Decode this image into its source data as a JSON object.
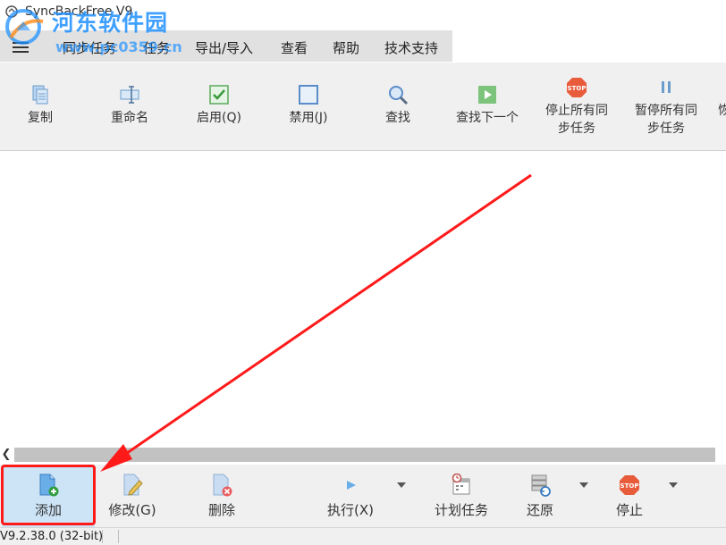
{
  "window": {
    "title": "SyncBackFree V9",
    "watermark_text": "河东软件园",
    "watermark_url": "www.pc0359.cn"
  },
  "menu": {
    "items": [
      "同步任务",
      "任务",
      "导出/导入",
      "查看",
      "帮助",
      "技术支持"
    ]
  },
  "toolbar": {
    "buttons": [
      {
        "label": "复制",
        "icon": "copy-icon"
      },
      {
        "label": "重命名",
        "icon": "rename-icon"
      },
      {
        "label": "启用(Q)",
        "icon": "enable-icon"
      },
      {
        "label": "禁用(J)",
        "icon": "disable-icon"
      },
      {
        "label": "查找",
        "icon": "search-icon"
      },
      {
        "label": "查找下一个",
        "icon": "find-next-icon"
      },
      {
        "label_line1": "停止所有同",
        "label_line2": "步任务",
        "icon": "stop-all-icon"
      },
      {
        "label_line1": "暂停所有同",
        "label_line2": "步任务",
        "icon": "pause-all-icon"
      },
      {
        "label": "恢",
        "icon": "resume-all-icon"
      }
    ]
  },
  "bottom_toolbar": {
    "buttons": [
      {
        "label": "添加",
        "icon": "add-icon"
      },
      {
        "label": "修改(G)",
        "icon": "modify-icon"
      },
      {
        "label": "删除",
        "icon": "delete-icon"
      },
      {
        "label": "执行(X)",
        "icon": "run-icon"
      },
      {
        "label": "计划任务",
        "icon": "schedule-icon"
      },
      {
        "label": "还原",
        "icon": "restore-icon"
      },
      {
        "label": "停止",
        "icon": "stop-icon"
      }
    ]
  },
  "status": {
    "version": "V9.2.38.0 (32-bit)"
  },
  "colors": {
    "annotation_red": "#ff1a1a",
    "highlight": "#cde4f7",
    "watermark_blue": "#1e90ff"
  }
}
